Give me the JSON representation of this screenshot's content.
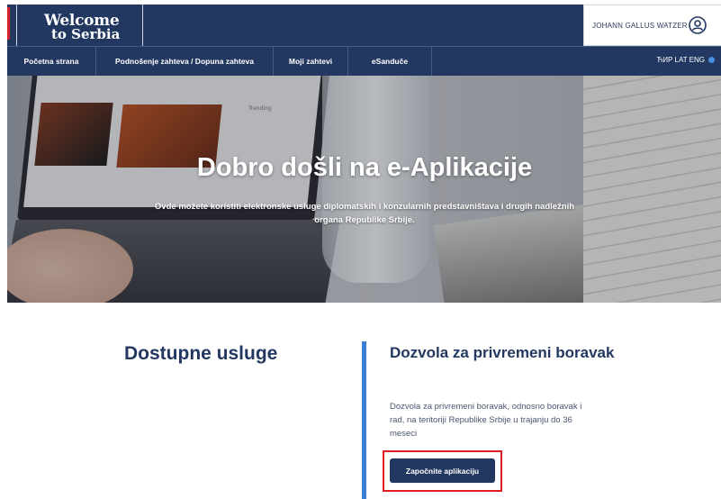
{
  "header": {
    "logo_line1": "Welcome",
    "logo_line2": "to Serbia",
    "user_name": "JOHANN GALLUS WATZER"
  },
  "nav": {
    "items": [
      {
        "label": "Početna strana"
      },
      {
        "label": "Podnošenje zahteva / Dopuna zahteva"
      },
      {
        "label": "Moji zahtevi"
      },
      {
        "label": "eSandučе"
      }
    ],
    "languages": "ЋИР LAT ENG"
  },
  "hero": {
    "title": "Dobro došli na e-Aplikacije",
    "subtitle": "Ovde možete koristiti elektronske usluge diplomatskih i konzularnih predstavništava i drugih nadležnih organa Republike Srbije.",
    "laptop_label": "Trending"
  },
  "main": {
    "section_title": "Dostupne usluge",
    "card": {
      "title": "Dozvola za privremeni boravak",
      "description": "Dozvola za privremeni boravak, odnosno boravak i rad, na teritoriji Republike Srbije u trajanju do 36 meseci",
      "button_label": "Započnite aplikaciju"
    }
  },
  "colors": {
    "navy": "#233860",
    "accent_blue": "#3a7fd5",
    "highlight_red": "#e01b22"
  }
}
